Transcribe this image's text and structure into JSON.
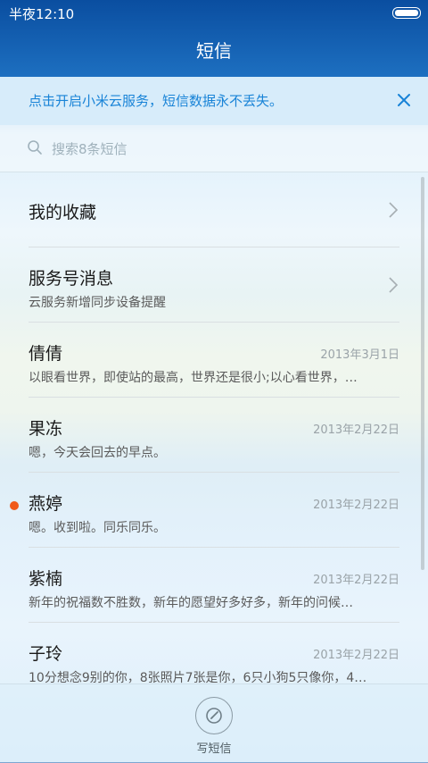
{
  "status": {
    "time": "半夜12:10"
  },
  "header": {
    "title": "短信"
  },
  "banner": {
    "text": "点击开启小米云服务，短信数据永不丢失。",
    "close_icon": "close-icon"
  },
  "search": {
    "placeholder": "搜索8条短信"
  },
  "list": [
    {
      "name": "我的收藏",
      "preview": "",
      "date": "",
      "chevron": true,
      "unread": false
    },
    {
      "name": "服务号消息",
      "preview": "云服务新增同步设备提醒",
      "date": "",
      "chevron": true,
      "unread": false
    },
    {
      "name": "倩倩",
      "preview": "以眼看世界，即使站的最高，世界还是很小;以心看世界，…",
      "date": "2013年3月1日",
      "chevron": false,
      "unread": false
    },
    {
      "name": "果冻",
      "preview": "嗯，今天会回去的早点。",
      "date": "2013年2月22日",
      "chevron": false,
      "unread": false
    },
    {
      "name": "燕婷",
      "preview": "嗯。收到啦。同乐同乐。",
      "date": "2013年2月22日",
      "chevron": false,
      "unread": true
    },
    {
      "name": "紫楠",
      "preview": "新年的祝福数不胜数，新年的愿望好多好多，新年的问候…",
      "date": "2013年2月22日",
      "chevron": false,
      "unread": false
    },
    {
      "name": "子玲",
      "preview": "10分想念9别的你，8张照片7张是你，6只小狗5只像你，4…",
      "date": "2013年2月22日",
      "chevron": false,
      "unread": false
    }
  ],
  "bottom": {
    "compose_label": "写短信"
  },
  "colors": {
    "accent": "#1883d7",
    "header": "#1060b3",
    "unread_dot": "#f05a1a"
  }
}
